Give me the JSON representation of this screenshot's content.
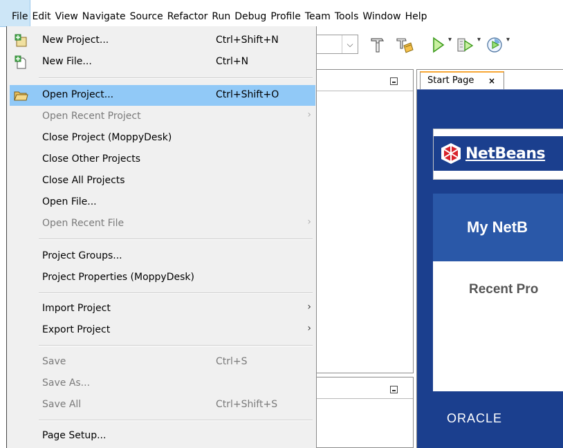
{
  "menubar": {
    "items": [
      "File",
      "Edit",
      "View",
      "Navigate",
      "Source",
      "Refactor",
      "Run",
      "Debug",
      "Profile",
      "Team",
      "Tools",
      "Window",
      "Help"
    ]
  },
  "file_menu": {
    "items": [
      {
        "label": "New Project...",
        "shortcut": "Ctrl+Shift+N",
        "icon": "new-project-icon"
      },
      {
        "label": "New File...",
        "shortcut": "Ctrl+N",
        "icon": "new-file-icon"
      },
      {
        "label": "Open Project...",
        "shortcut": "Ctrl+Shift+O",
        "icon": "open-project-icon"
      },
      {
        "label": "Open Recent Project",
        "submenu_glyph": "›"
      },
      {
        "label": "Close Project (MoppyDesk)"
      },
      {
        "label": "Close Other Projects"
      },
      {
        "label": "Close All Projects"
      },
      {
        "label": "Open File..."
      },
      {
        "label": "Open Recent File",
        "submenu_glyph": "›"
      },
      {
        "label": "Project Groups..."
      },
      {
        "label": "Project Properties (MoppyDesk)"
      },
      {
        "label": "Import Project",
        "submenu_glyph": "›"
      },
      {
        "label": "Export Project",
        "submenu_glyph": "›"
      },
      {
        "label": "Save",
        "shortcut": "Ctrl+S"
      },
      {
        "label": "Save As..."
      },
      {
        "label": "Save All",
        "shortcut": "Ctrl+Shift+S"
      },
      {
        "label": "Page Setup..."
      }
    ]
  },
  "toolbar": {
    "combo_arrow": "⌵",
    "drop_glyph": "▾"
  },
  "editor": {
    "tab_label": "Start Page",
    "tab_close": "×"
  },
  "start_page": {
    "logo_text": "NetBeans",
    "heading": "My NetB",
    "recent_heading": "Recent Pro",
    "footer_brand": "ORACLE"
  },
  "colors": {
    "highlight": "#91c9f7",
    "menu_bg": "#f0f0f0",
    "netbeans_blue": "#1b3f8e",
    "tab_accent": "#f7a635"
  }
}
